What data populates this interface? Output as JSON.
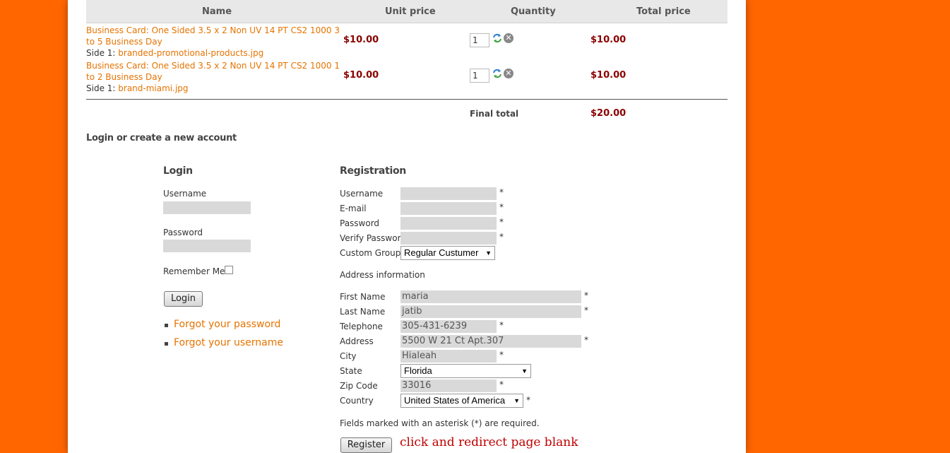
{
  "cart": {
    "columns": [
      "Name",
      "Unit price",
      "Quantity",
      "Total price"
    ],
    "items": [
      {
        "title": "Business Card: One Sided 3.5 x 2 Non UV 14 PT CS2 1000 3 to 5 Business Day",
        "side_label": "Side 1:",
        "file": "branded-promotional-products.jpg",
        "unit_price": "$10.00",
        "quantity": "1",
        "total": "$10.00"
      },
      {
        "title": "Business Card: One Sided 3.5 x 2 Non UV 14 PT CS2 1000 1 to 2 Business Day",
        "side_label": "Side 1:",
        "file": "brand-miami.jpg",
        "unit_price": "$10.00",
        "quantity": "1",
        "total": "$10.00"
      }
    ],
    "final_total_label": "Final total",
    "final_total": "$20.00"
  },
  "account": {
    "section_title": "Login or create a new account",
    "login": {
      "heading": "Login",
      "username_label": "Username",
      "password_label": "Password",
      "remember_label": "Remember Me",
      "button": "Login",
      "links": [
        "Forgot your password",
        "Forgot your username"
      ]
    },
    "registration": {
      "heading": "Registration",
      "username_label": "Username",
      "email_label": "E-mail",
      "password_label": "Password",
      "verify_label": "Verify Password",
      "group_label": "Custom Group",
      "group_value": "Regular Custumer",
      "address_heading": "Address information",
      "first_name_label": "First Name",
      "first_name": "maria",
      "last_name_label": "Last Name",
      "last_name": "jatib",
      "telephone_label": "Telephone",
      "telephone": "305-431-6239",
      "address_label": "Address",
      "address": "5500 W 21 Ct Apt.307",
      "city_label": "City",
      "city": "Hialeah",
      "state_label": "State",
      "state": "Florida",
      "zip_label": "Zip Code",
      "zip": "33016",
      "country_label": "Country",
      "country": "United States of America",
      "required_note": "Fields marked with an asterisk (*) are required.",
      "button": "Register",
      "star": "*"
    }
  },
  "annotation": "click and redirect page blank",
  "colors": {
    "background": "#ff6600",
    "link": "#e67300",
    "price": "#8b0000",
    "annotation": "#c00000"
  }
}
